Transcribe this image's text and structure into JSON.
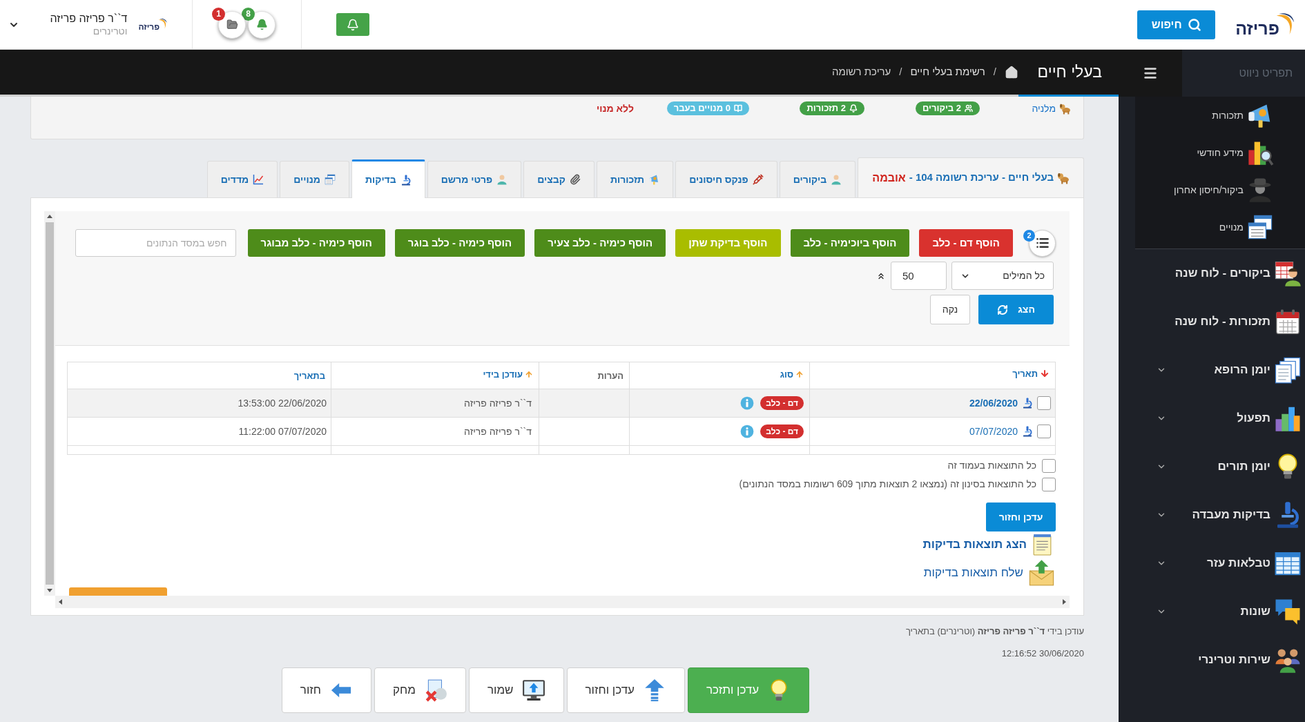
{
  "header": {
    "logo": "פריזה",
    "search_button": "חיפוש",
    "notifications": [
      {
        "kind": "bell",
        "count": "8",
        "color": "#43a047"
      },
      {
        "kind": "folder",
        "count": "1",
        "color": "#d32f2f"
      }
    ],
    "user": {
      "logo": "פריזה",
      "name": "ד``ר פריזה פריזה",
      "role": "וטרינרים"
    }
  },
  "nav_bar": {
    "title": "בעלי חיים",
    "breadcrumb": [
      {
        "separator": "/",
        "label": "רשימת בעלי חיים"
      },
      {
        "separator": "/",
        "label": "עריכת רשומה"
      }
    ]
  },
  "sidebar": {
    "title": "תפריט ניווט",
    "submenu": [
      "תזכורות",
      "מידע חודשי",
      "ביקור/חיסון אחרון",
      "מנויים"
    ],
    "items": [
      {
        "label": "ביקורים - לוח שנה",
        "collapsible": false
      },
      {
        "label": "תזכורות - לוח שנה",
        "collapsible": false
      },
      {
        "label": "יומן הרופא",
        "collapsible": true
      },
      {
        "label": "תפעול",
        "collapsible": true
      },
      {
        "label": "יומן תורים",
        "collapsible": true
      },
      {
        "label": "בדיקות מעבדה",
        "collapsible": true
      },
      {
        "label": "טבלאות עזר",
        "collapsible": true
      },
      {
        "label": "שונות",
        "collapsible": true
      },
      {
        "label": "שירות וטרינרי",
        "collapsible": false
      }
    ]
  },
  "summary": {
    "pet_name": "מלניה",
    "badges": [
      {
        "kind": "visits",
        "text": "2 ביקורים",
        "color": "#43a047"
      },
      {
        "kind": "reminders",
        "text": "2 תזכורות",
        "color": "#43a047"
      },
      {
        "kind": "subscriptions",
        "text": "0 מנויים בעבר",
        "color": "#5bc0de"
      }
    ],
    "subscription": "ללא מנוי"
  },
  "record_tab": {
    "title": "בעלי חיים - עריכת רשומה 104 -",
    "pet_name": "אובמה"
  },
  "tabs": [
    {
      "label": "ביקורים",
      "selected": false
    },
    {
      "label": "פנקס חיסונים",
      "selected": false
    },
    {
      "label": "תזכורות",
      "selected": false
    },
    {
      "label": "קבצים",
      "selected": false
    },
    {
      "label": "פרטי מרשם",
      "selected": false
    },
    {
      "label": "בדיקות",
      "selected": true
    },
    {
      "label": "מנויים",
      "selected": false
    },
    {
      "label": "מדדים",
      "selected": false
    }
  ],
  "toolbar": {
    "list_badge": "2",
    "add_buttons": [
      {
        "label": "הוסף דם - כלב",
        "color": "#d9322e"
      },
      {
        "label": "הוסף ביוכימיה - כלב",
        "color": "#4e8c1a"
      },
      {
        "label": "הוסף בדיקת שתן",
        "color": "#a9bd00"
      },
      {
        "label": "הוסף כימיה - כלב צעיר",
        "color": "#4e8c1a"
      },
      {
        "label": "הוסף כימיה - כלב בוגר",
        "color": "#4e8c1a"
      },
      {
        "label": "הוסף כימיה - כלב מבוגר",
        "color": "#4e8c1a"
      }
    ],
    "search": {
      "placeholder": "חפש במסד הנתונים"
    },
    "match_mode": "כל המילים",
    "page_size": "50",
    "show_button": "הצג",
    "clear_button": "נקה"
  },
  "table": {
    "columns": [
      {
        "label": "תאריך",
        "sortable": true,
        "sorted": true,
        "descending": true
      },
      {
        "label": "סוג",
        "sortable": true,
        "sorted": true,
        "descending": false
      },
      {
        "label": "הערות",
        "sortable": false,
        "sorted": false
      },
      {
        "label": "עודכן בידי",
        "sortable": true,
        "sorted": true,
        "descending": false
      },
      {
        "label": "בתאריך",
        "sortable": true,
        "sorted": false
      }
    ],
    "rows": [
      {
        "highlighted": true,
        "checked": false,
        "date": "22/06/2020",
        "type": "דם - כלב",
        "updated_by": "ד``ר פריזה פריזה",
        "updated_at": "13:53:00 22/06/2020"
      },
      {
        "highlighted": false,
        "checked": false,
        "date": "07/07/2020",
        "type": "דם - כלב",
        "updated_by": "ד``ר פריזה פריזה",
        "updated_at": "11:22:00 07/07/2020"
      }
    ]
  },
  "select_all": [
    {
      "label": "כל התוצאות בעמוד זה",
      "checked": false
    },
    {
      "label": "כל התוצאות בסינון זה (נמצאו 2 תוצאות מתוך 609 רשומות במסד הנתונים)",
      "checked": false
    }
  ],
  "update_button": "עדכן וחזור",
  "links": [
    {
      "kind": "view",
      "text": "הצג תוצאות בדיקות"
    },
    {
      "kind": "send",
      "text": "שלח תוצאות בדיקות"
    }
  ],
  "footer": {
    "updated_note": "עודכן בידי **ד``ר פריזה פריזה** (וטרינרים) בתאריך",
    "updated_at": "12:16:52 30/06/2020"
  },
  "actions": [
    {
      "kind": "remind",
      "label": "עדכן ותזכר"
    },
    {
      "kind": "update",
      "label": "עדכן וחזור"
    },
    {
      "kind": "save",
      "label": "שמור"
    },
    {
      "kind": "delete",
      "label": "מחק"
    },
    {
      "kind": "back",
      "label": "חזור"
    }
  ]
}
